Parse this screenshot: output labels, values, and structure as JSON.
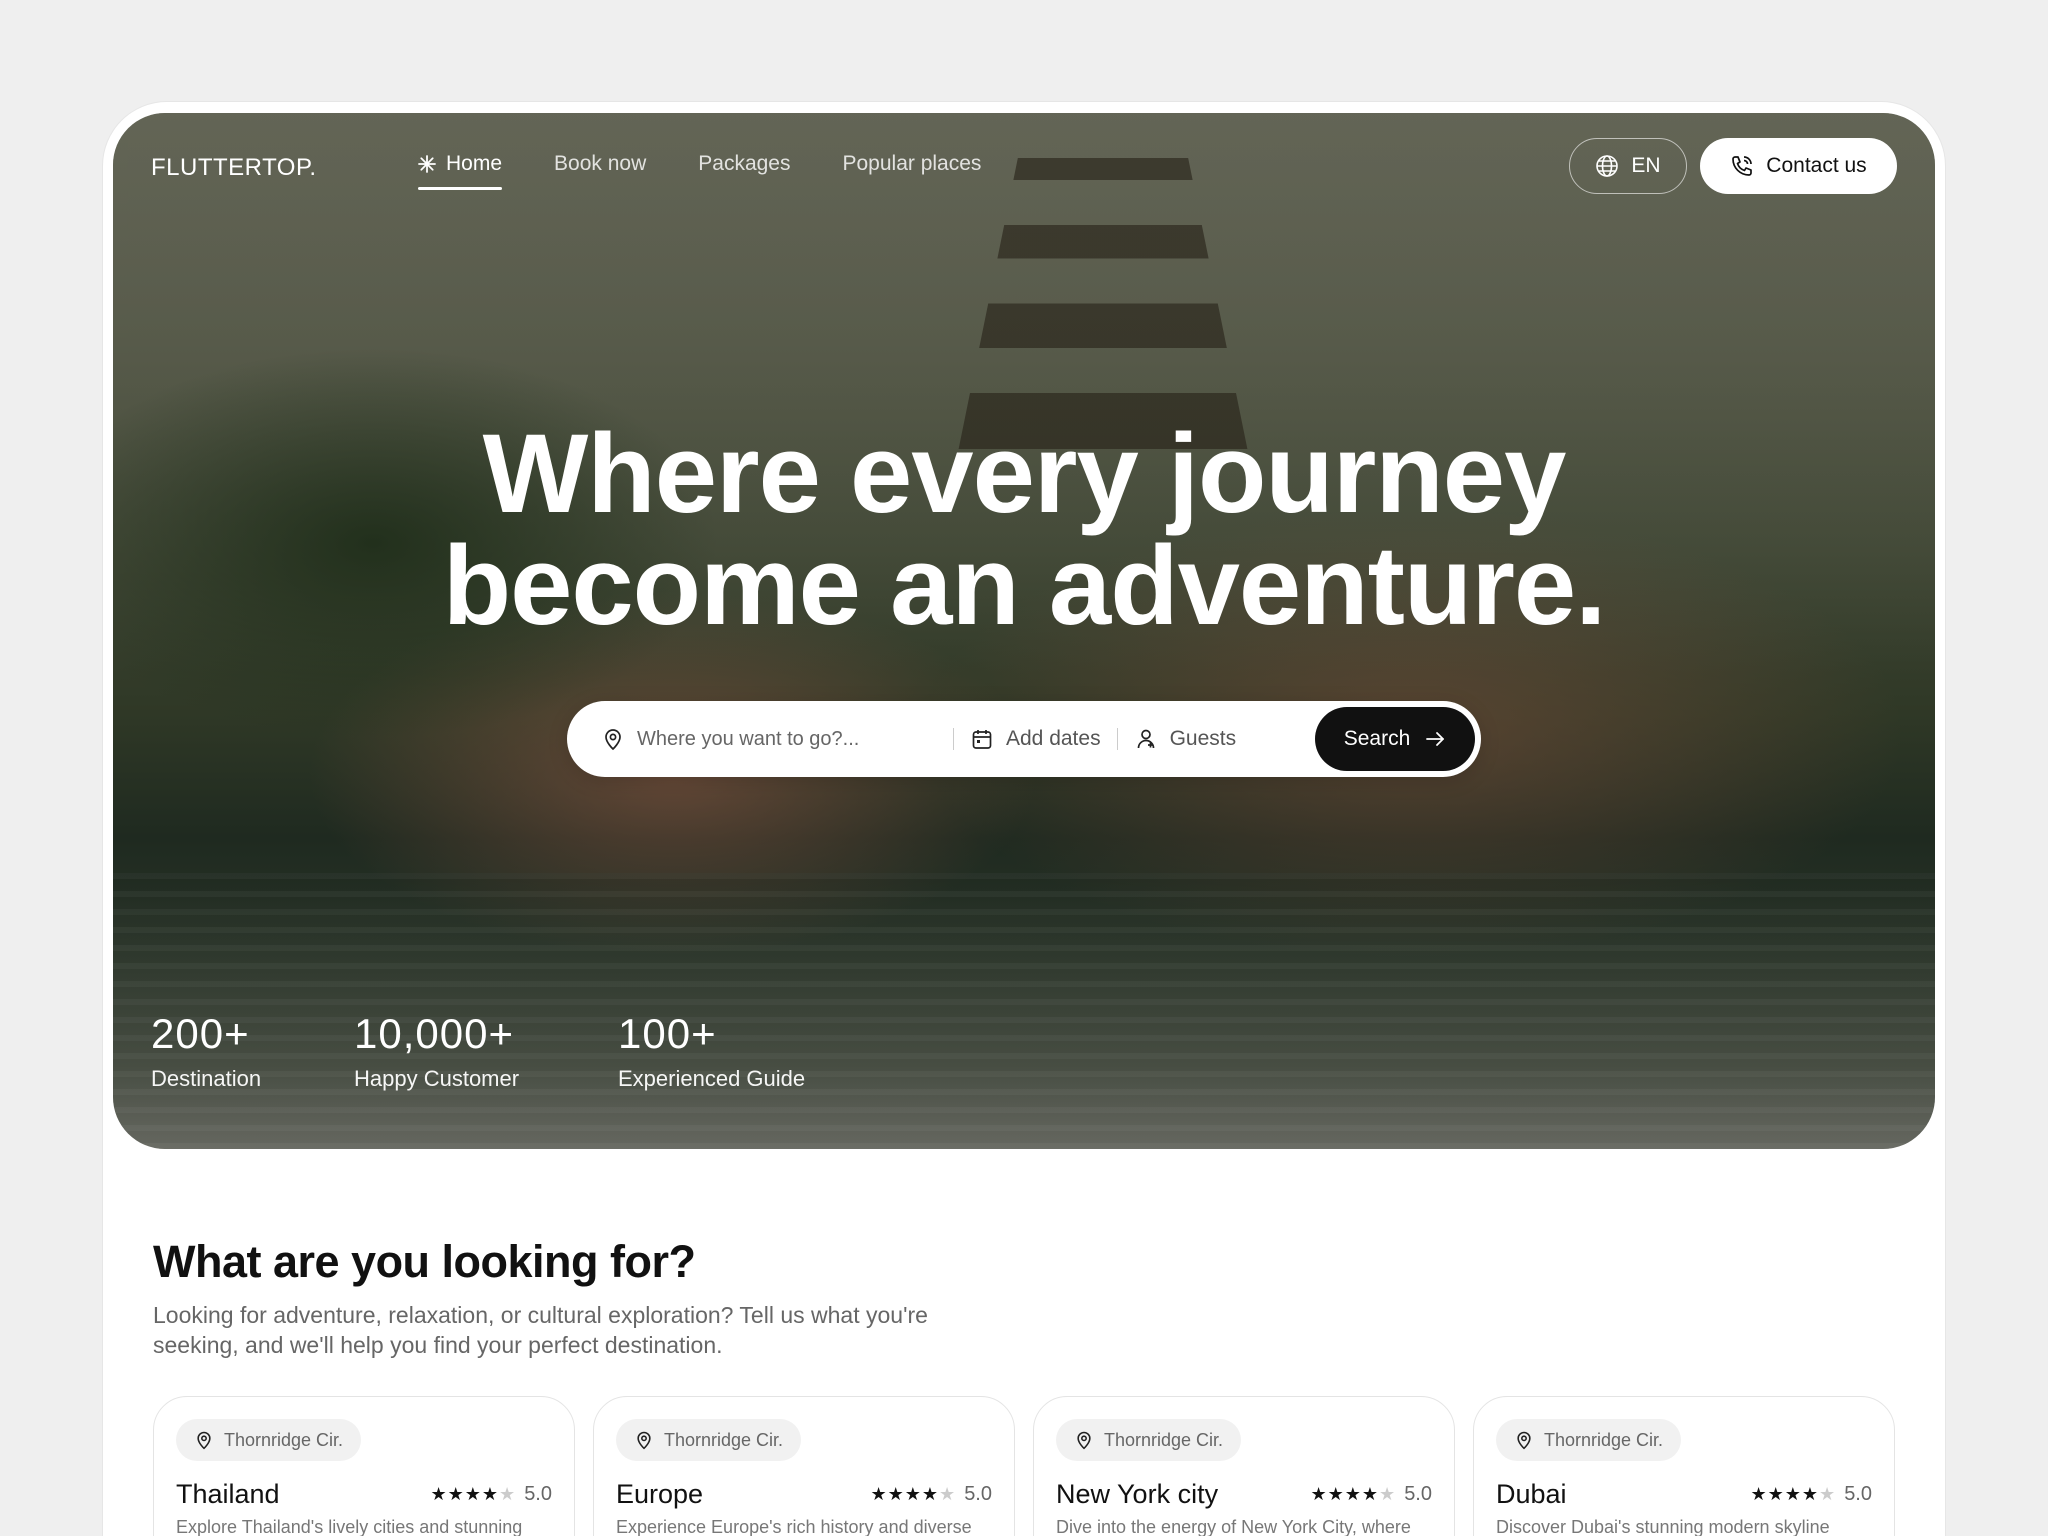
{
  "brand": {
    "logo": "FLUTTERTOP."
  },
  "nav": {
    "items": [
      {
        "label": "Home",
        "active": true
      },
      {
        "label": "Book now",
        "active": false
      },
      {
        "label": "Packages",
        "active": false
      },
      {
        "label": "Popular places",
        "active": false
      }
    ],
    "language": "EN",
    "contact_label": "Contact us"
  },
  "hero": {
    "headline_line1": "Where every journey",
    "headline_line2": "become an adventure."
  },
  "search": {
    "where_placeholder": "Where you want to go?...",
    "dates_label": "Add dates",
    "guests_label": "Guests",
    "button_label": "Search"
  },
  "stats": [
    {
      "value": "200+",
      "label": "Destination"
    },
    {
      "value": "10,000+",
      "label": "Happy Customer"
    },
    {
      "value": "100+",
      "label": "Experienced Guide"
    }
  ],
  "section": {
    "title": "What are you looking for?",
    "description": "Looking for adventure, relaxation, or cultural exploration? Tell us what you're seeking, and we'll help you find your perfect destination."
  },
  "cards": [
    {
      "location": "Thornridge Cir.",
      "title": "Thailand",
      "rating": "5.0",
      "description": "Explore Thailand's lively cities and stunning"
    },
    {
      "location": "Thornridge Cir.",
      "title": "Europe",
      "rating": "5.0",
      "description": "Experience Europe's rich history and diverse"
    },
    {
      "location": "Thornridge Cir.",
      "title": "New York city",
      "rating": "5.0",
      "description": "Dive into the energy of New York City, where"
    },
    {
      "location": "Thornridge Cir.",
      "title": "Dubai",
      "rating": "5.0",
      "description": "Discover Dubai's stunning modern skyline"
    }
  ],
  "colors": {
    "accent": "#111111",
    "page_bg": "#efefef"
  }
}
